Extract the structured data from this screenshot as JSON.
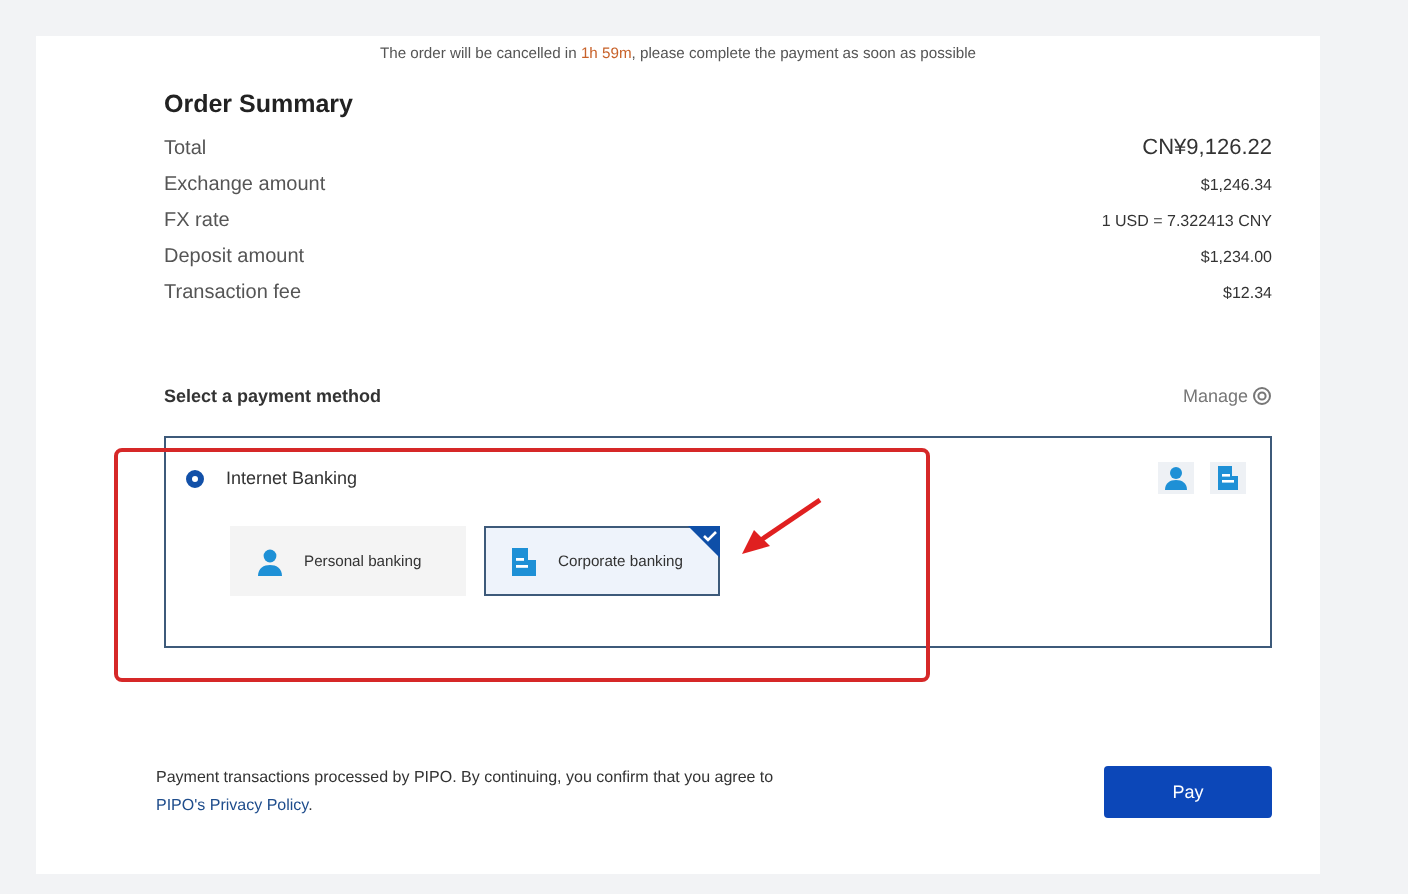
{
  "notice": {
    "before": "The order will be cancelled in ",
    "countdown": "1h 59m",
    "after": ", please complete the payment as soon as possible"
  },
  "summary": {
    "title": "Order Summary",
    "rows": [
      {
        "label": "Total",
        "value": "CN¥9,126.22",
        "kind": "total"
      },
      {
        "label": "Exchange amount",
        "value": "$1,246.34",
        "kind": "detail"
      },
      {
        "label": "FX rate",
        "value": "1 USD = 7.322413 CNY",
        "kind": "detail"
      },
      {
        "label": "Deposit amount",
        "value": "$1,234.00",
        "kind": "detail"
      },
      {
        "label": "Transaction fee",
        "value": "$12.34",
        "kind": "detail"
      }
    ]
  },
  "payment": {
    "title": "Select a payment method",
    "manage": "Manage",
    "method": {
      "label": "Internet Banking",
      "selected": true,
      "options": [
        {
          "label": "Personal banking",
          "kind": "personal",
          "selected": false
        },
        {
          "label": "Corporate banking",
          "kind": "corporate",
          "selected": true
        }
      ]
    }
  },
  "footer": {
    "text": "Payment transactions processed by PIPO. By continuing, you confirm that you agree to ",
    "link": "PIPO's Privacy Policy",
    "end": ".",
    "button": "Pay"
  }
}
